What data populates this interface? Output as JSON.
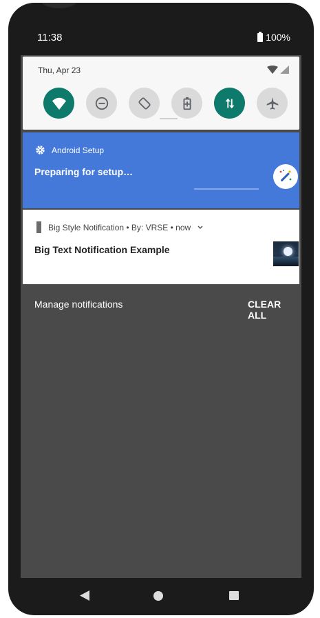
{
  "status_bar": {
    "time": "11:38",
    "battery": "100%"
  },
  "quick_settings": {
    "date": "Thu, Apr 23",
    "tiles": [
      {
        "name": "wifi-icon",
        "active": true
      },
      {
        "name": "do-not-disturb-icon",
        "active": false
      },
      {
        "name": "auto-rotate-icon",
        "active": false
      },
      {
        "name": "battery-saver-icon",
        "active": false
      },
      {
        "name": "mobile-data-icon",
        "active": true
      },
      {
        "name": "airplane-mode-icon",
        "active": false
      }
    ]
  },
  "notifications": [
    {
      "app": "Android Setup",
      "title": "Preparing for setup…",
      "icon": "wand-icon"
    },
    {
      "header": "Big Style Notification • By: VRSE • now",
      "title": "Big Text Notification Example",
      "icon": "moon-thumbnail"
    }
  ],
  "footer": {
    "manage": "Manage notifications",
    "clear_all": "CLEAR ALL"
  },
  "colors": {
    "status_bar": "#1b1b1b",
    "screen_bg": "#4a4a4a",
    "setup_notification": "#4479d9",
    "active_tile": "#0d7a6b",
    "inactive_tile": "#dadada"
  }
}
